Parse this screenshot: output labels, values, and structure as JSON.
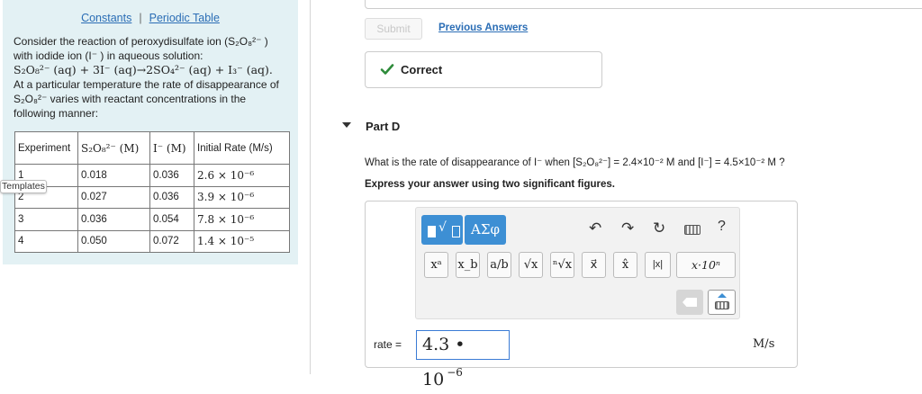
{
  "left_panel": {
    "links": {
      "constants": "Constants",
      "separator": "|",
      "periodic_table": "Periodic Table"
    },
    "problem": {
      "line1": "Consider the reaction of peroxydisulfate ion (S₂O₈²⁻ )",
      "line2": "with iodide ion (I⁻ ) in aqueous solution:",
      "line3": "S₂O₈²⁻ (aq) + 3I⁻ (aq)→2SO₄²⁻ (aq) + I₃⁻ (aq).",
      "line4": "At a particular temperature the rate of disappearance of",
      "line5": "S₂O₈²⁻ varies with reactant concentrations in the",
      "line6": "following manner:"
    },
    "table": {
      "headers": [
        "Experiment",
        "S₂O₈²⁻ (M)",
        "I⁻ (M)",
        "Initial Rate (M/s)"
      ],
      "rows": [
        [
          "1",
          "0.018",
          "0.036",
          "2.6 × 10⁻⁶"
        ],
        [
          "2",
          "0.027",
          "0.036",
          "3.9 × 10⁻⁶"
        ],
        [
          "3",
          "0.036",
          "0.054",
          "7.8 × 10⁻⁶"
        ],
        [
          "4",
          "0.050",
          "0.072",
          "1.4 × 10⁻⁵"
        ]
      ]
    },
    "templates_tab": "Templates"
  },
  "right_panel": {
    "submit_label": "Submit",
    "previous_answers": "Previous Answers",
    "correct_text": "Correct",
    "part_label": "Part D",
    "question": "What is the rate of disappearance of I⁻ when [S₂O₈²⁻] = 2.4×10⁻² M and [I⁻] = 4.5×10⁻² M ?",
    "instruction": "Express your answer using two significant figures.",
    "toolbar": {
      "greek": "ΑΣφ",
      "undo": "↶",
      "redo": "↷",
      "reset": "↻",
      "help": "?",
      "keys": [
        "xᵃ",
        "x_b",
        "a/b",
        "√x",
        "ⁿ√x",
        "x⃗",
        "x̂",
        "|x|",
        "x·10ⁿ"
      ]
    },
    "answer": {
      "label": "rate =",
      "mantissa": "4.3 • 10",
      "exponent": "−6",
      "unit": "M/s"
    }
  },
  "colors": {
    "accent": "#3d8fd4",
    "link": "#2a6db5",
    "correct_green": "#2e8b3a",
    "panel_bg": "#e3f1f4"
  }
}
